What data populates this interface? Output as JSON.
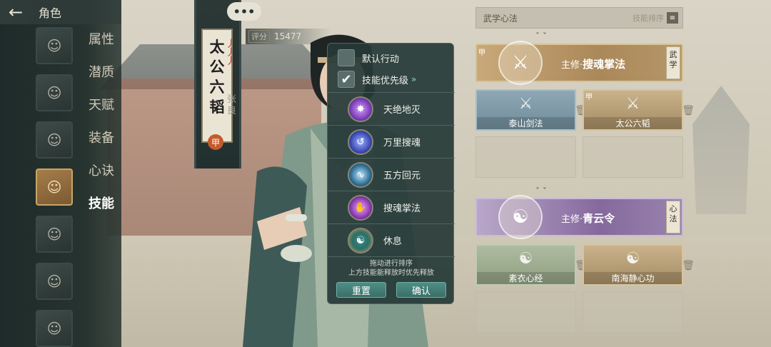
{
  "header": {
    "back_icon": "back-arrow-icon",
    "title": "角色"
  },
  "sidebar": {
    "menu": [
      {
        "label": "属性",
        "active": false
      },
      {
        "label": "潜质",
        "active": false
      },
      {
        "label": "天赋",
        "active": false
      },
      {
        "label": "装备",
        "active": false
      },
      {
        "label": "心诀",
        "active": false
      },
      {
        "label": "技能",
        "active": true
      }
    ],
    "selected_avatar_index": 2
  },
  "banner": {
    "title_chars": [
      "太",
      "公",
      "六",
      "韬"
    ],
    "side_text": "张良",
    "seal": "甲",
    "more_button": "•••"
  },
  "score": {
    "label": "评分",
    "value": "15477"
  },
  "popup": {
    "option_default": {
      "label": "默认行动",
      "checked": false
    },
    "option_priority": {
      "label": "技能优先级",
      "checked": true,
      "check_mark": "✔",
      "chevron": "»"
    },
    "skills": [
      {
        "name": "天绝地灭",
        "icon": "purple-burst-icon",
        "color": "#7b3fb8"
      },
      {
        "name": "万里搜魂",
        "icon": "blue-vortex-icon",
        "color": "#3b4bb3"
      },
      {
        "name": "五方回元",
        "icon": "cyan-swirl-icon",
        "color": "#2f6f93"
      },
      {
        "name": "搜魂掌法",
        "icon": "purple-palm-icon",
        "color": "#8a3bb0"
      },
      {
        "name": "休息",
        "icon": "meditation-icon",
        "color": "#2b6f6a"
      }
    ],
    "hint_line1": "拖动进行排序",
    "hint_line2": "上方技能能释放时优先释放",
    "reset_label": "重置",
    "confirm_label": "确认"
  },
  "right_panel": {
    "title": "武学心法",
    "sort_label": "技能排序",
    "sort_icon": "sort-icon",
    "main_cards": [
      {
        "prefix": "主修·",
        "name": "搜魂掌法",
        "tag": "武学",
        "corner": "甲",
        "theme": "gold"
      },
      {
        "prefix": "主修·",
        "name": "青云令",
        "tag": "心法",
        "corner": "",
        "theme": "purple"
      }
    ],
    "sub_cards": [
      {
        "name": "泰山剑法",
        "corner": "",
        "theme": "blue"
      },
      {
        "name": "太公六韬",
        "corner": "甲",
        "theme": "tan"
      },
      {
        "name": "素衣心经",
        "corner": "",
        "theme": "green"
      },
      {
        "name": "南海静心功",
        "corner": "",
        "theme": "tan"
      }
    ]
  }
}
